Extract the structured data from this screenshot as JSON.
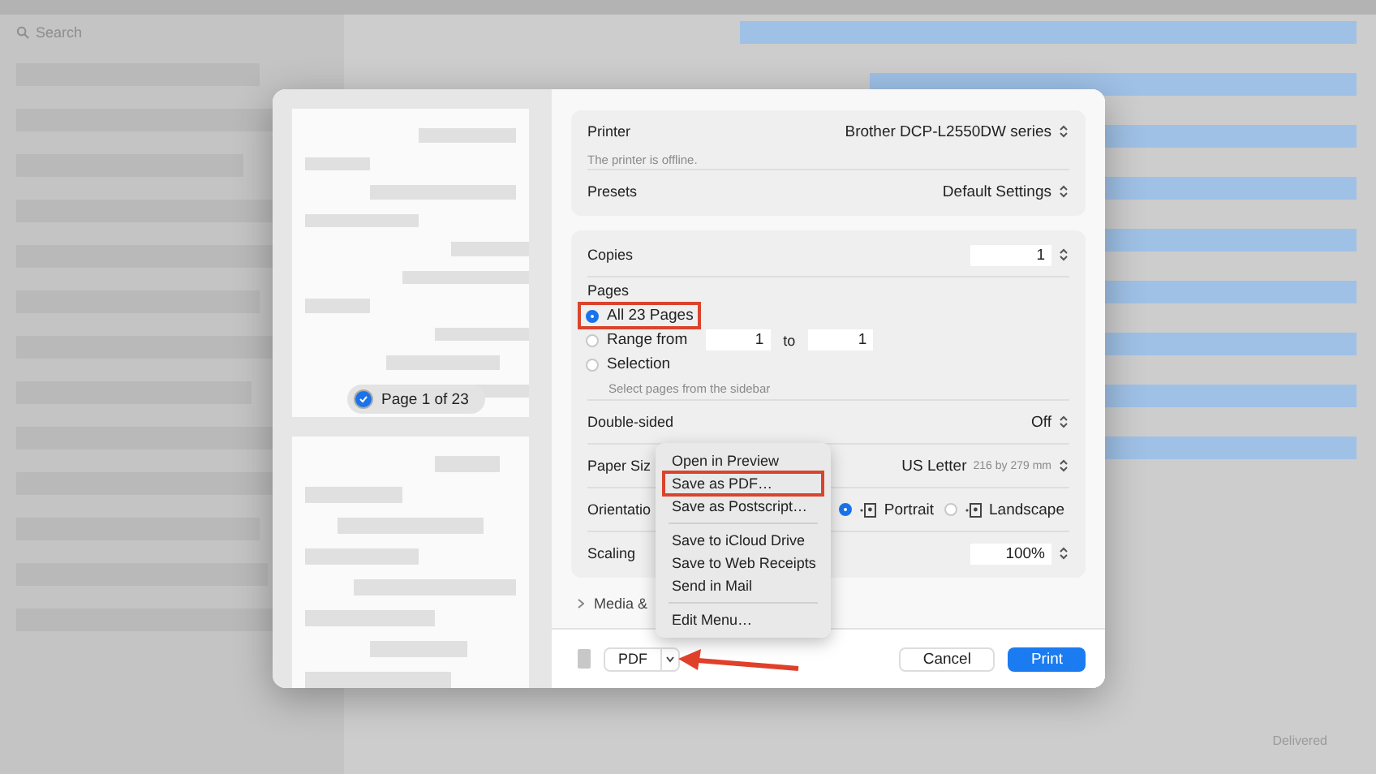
{
  "background": {
    "search": {
      "placeholder": "Search"
    },
    "status": "Delivered"
  },
  "preview": {
    "badge": {
      "label": "Page 1 of 23",
      "checked": true
    }
  },
  "printer": {
    "label": "Printer",
    "value": "Brother DCP-L2550DW series",
    "note": "The printer is offline."
  },
  "presets": {
    "label": "Presets",
    "value": "Default Settings"
  },
  "copies": {
    "label": "Copies",
    "value": "1"
  },
  "pages": {
    "heading": "Pages",
    "options": [
      {
        "kind": "all",
        "label": "All 23 Pages",
        "selected": true,
        "highlighted": true
      },
      {
        "kind": "range",
        "label": "Range from",
        "selected": false,
        "highlighted": false,
        "from": "1",
        "to_label": "to",
        "to": "1"
      },
      {
        "kind": "selection",
        "label": "Selection",
        "selected": false,
        "highlighted": false,
        "note": "Select pages from the sidebar"
      }
    ]
  },
  "settings": [
    {
      "kind": "select",
      "label": "Double-sided",
      "value": "Off"
    },
    {
      "kind": "select",
      "label": "Paper Siz",
      "value": "US Letter",
      "detail": "216 by 279 mm"
    },
    {
      "kind": "radio",
      "label": "Orientatio",
      "options": [
        {
          "label": "Portrait",
          "selected": true
        },
        {
          "label": "Landscape",
          "selected": false
        }
      ]
    },
    {
      "kind": "stepper",
      "label": "Scaling",
      "value": "100%"
    }
  ],
  "media": {
    "label": "Media &"
  },
  "menu": {
    "groups": [
      [
        {
          "label": "Open in Preview",
          "highlighted": false
        },
        {
          "label": "Save as PDF…",
          "highlighted": true
        },
        {
          "label": "Save as Postscript…",
          "highlighted": false
        }
      ],
      [
        {
          "label": "Save to iCloud Drive",
          "highlighted": false
        },
        {
          "label": "Save to Web Receipts",
          "highlighted": false
        },
        {
          "label": "Send in Mail",
          "highlighted": false
        }
      ],
      [
        {
          "label": "Edit Menu…",
          "highlighted": false
        }
      ]
    ]
  },
  "footer": {
    "pdf": "PDF",
    "cancel": "Cancel",
    "print": "Print"
  }
}
